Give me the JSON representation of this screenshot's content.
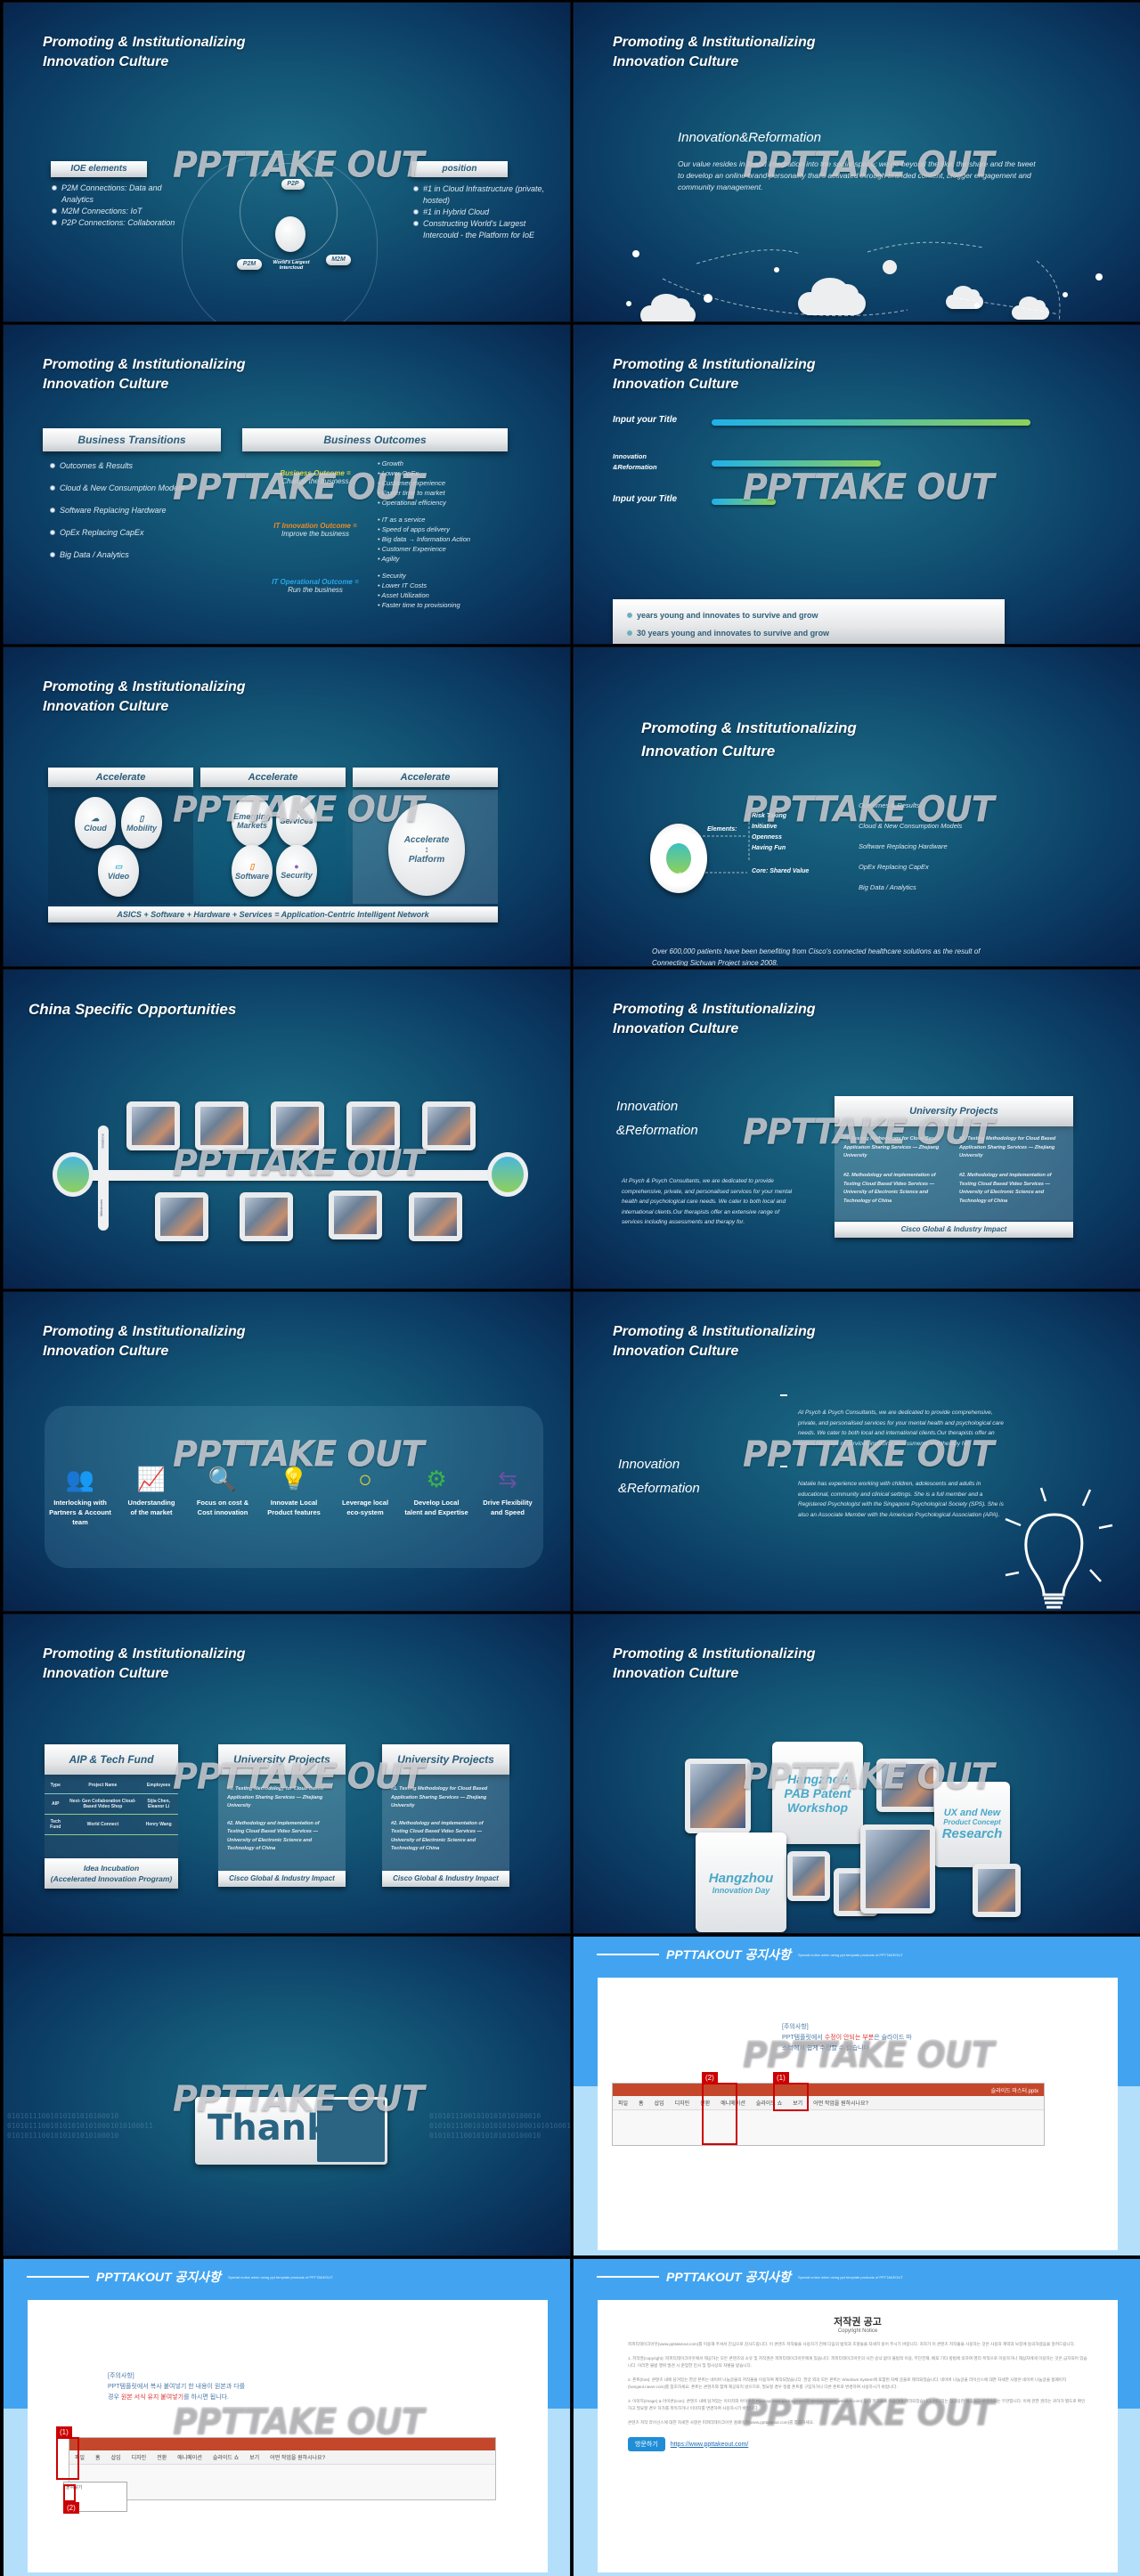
{
  "watermark": "PPTTAKE OUT",
  "common_title": "Promoting & Institutionalizing\nInnovation Culture",
  "footer_quote": "Over 600,000 patients have been benefiting from Cisco's connected healthcare solutions as the result of Connecting Sichuan Project since 2008.",
  "slides": {
    "s1": {
      "left_header": "IOE elements",
      "left_items": [
        "P2M Connections: Data and Analytics",
        "M2M Connections:  IoT",
        "P2P Connections: Collaboration"
      ],
      "center_labels": {
        "p2p": "P2P",
        "p2m": "P2M",
        "m2m": "M2M",
        "core": "World's Largest Intercloud"
      },
      "right_header": "position",
      "right_items": [
        "#1 in Cloud Infrastructure (private, hosted)",
        "#1 in Hybrid Cloud",
        "Constructing World's Largest Intercould - the Platform for IoE"
      ]
    },
    "s2": {
      "heading": "Innovation&Reformation",
      "body": "Our value resides in brand integration into the social space; we go beyond the like, the share and the tweet to develop an online brand personality that's activated through branded content, blogger engagement and community management."
    },
    "s3": {
      "left_header": "Business Transitions",
      "left_items": [
        "Outcomes & Results",
        "Cloud & New Consumption Models",
        "Software Replacing Hardware",
        "OpEx Replacing CapEx",
        "Big Data / Analytics"
      ],
      "right_header": "Business Outcomes",
      "outcomes": [
        {
          "label": "Business Outcome",
          "eq": "=",
          "sub": "Change the business",
          "color": "#e8d43a",
          "items": [
            "Growth",
            "Lower OpEx",
            "Customer experience",
            "Faster time to market",
            "Operational efficiency"
          ]
        },
        {
          "label": "IT Innovation Outcome",
          "eq": "=",
          "sub": "Improve the business",
          "color": "#f08a24",
          "items": [
            "IT as a service",
            "Speed of apps delivery",
            "Big data → Information Action",
            "Customer Experience",
            "Agility"
          ]
        },
        {
          "label": "IT Operational Outcome",
          "eq": "=",
          "sub": "Run the business",
          "color": "#2aa8e8",
          "items": [
            "Security",
            "Lower IT Costs",
            "Asset Utilization",
            "Faster time to provisioning"
          ]
        }
      ]
    },
    "s4": {
      "bars": [
        {
          "label": "Input your Title",
          "fraction": 1.0
        },
        {
          "label": "Innovation\n&Reformation",
          "fraction": 0.53
        },
        {
          "label": "Input your Title",
          "fraction": 0.2
        }
      ],
      "box_items": [
        "years young and innovates to survive and grow",
        "30 years young and innovates to survive and grow"
      ]
    },
    "s5": {
      "headers": [
        "Accelerate",
        "Accelerate",
        "Accelerate"
      ],
      "group1": [
        "Cloud",
        "Mobility",
        "Video"
      ],
      "group2": [
        "Emerging Markets",
        "Services",
        "Software",
        "Security"
      ],
      "group3": {
        "top": "Accelerate",
        "bottom": "Platform"
      },
      "footer": "ASICS + Software + Hardware + Services = Application-Centric Intelligent Network"
    },
    "s6": {
      "elements_label": "Elements:",
      "elements": [
        "Risk Taking",
        "Initiative",
        "Openness",
        "Having Fun"
      ],
      "core_label": "Core:  Shared Value",
      "right_items": [
        "Outcomes & Results",
        "Cloud & New Consumption Models",
        "Software Replacing Hardware",
        "OpEx Replacing CapEx",
        "Big Data / Analytics"
      ]
    },
    "s7": {
      "title": "China Specific Opportunities",
      "axis_top": "Solutions",
      "axis_bottom": "Milestones"
    },
    "s8": {
      "heading": "Innovation\n&Reformation",
      "body": "At Psych & Psych Consultants, we are dedicated to provide comprehensive, private, and personalised services for your mental health and psychological care needs. We cater to both local and international clients.Our therapists offer an extensive range of services including assessments and therapy for.",
      "card_header": "University  Projects",
      "card_items": [
        "#1. Testing Methodology for Cloud Based Application Sharing Services — Zhejiang University",
        "#1. Testing Methodology for Cloud Based Application Sharing Services — Zhejiang University",
        "#2. Methodology and implementation of Testing Cloud Based Video Services — University of Electronic Science and Technology of China",
        "#2. Methodology and implementation of Testing Cloud Based Video Services — University of Electronic Science and Technology of China"
      ],
      "card_footer": "Cisco Global & Industry Impact"
    },
    "s9": {
      "items": [
        {
          "label": "Interlocking with\nPartners & Account team",
          "icon": "people-icon",
          "color": "#2aa8e0"
        },
        {
          "label": "Understanding\nof the market",
          "icon": "chart-icon",
          "color": "#8cc63f"
        },
        {
          "label": "Focus on cost &\nCost innovation",
          "icon": "magnifier-icon",
          "color": "#4aa3df"
        },
        {
          "label": "Innovate Local\nProduct features",
          "icon": "lightbulb-icon",
          "color": "#f7941d"
        },
        {
          "label": "Leverage local\neco-system",
          "icon": "rings-icon",
          "color": "#e5d23a"
        },
        {
          "label": "Develop Local\ntalent and Expertise",
          "icon": "gears-icon",
          "color": "#39b54a"
        },
        {
          "label": "Drive Flexibility\nand Speed",
          "icon": "arrows-icon",
          "color": "#6b4fa0"
        }
      ]
    },
    "s10": {
      "heading": "Innovation\n&Reformation",
      "para1": "At Psych & Psych Consultants, we are dedicated to provide comprehensive, private, and personalised services for your mental health and psychological care needs. We cater to both local and international clients.Our therapists offer an extensive range of services including assessments and therapy for.",
      "para2": "Natalie has experience working with children, adolescents and adults in educational, community and clinical settings. She is a full member and a Registered Psychologist with the Singapore Psychological Society (SPS). She is also an Associate Member with the American Psychological Association (APA)."
    },
    "s11": {
      "card1": {
        "header": "AIP & Tech Fund",
        "columns": [
          "Type",
          "Project Name",
          "Employees"
        ],
        "rows": [
          [
            "AIP",
            "Next- Gen Collaboration Cloud- Based Video Shop",
            "Sijia Chen, Eleanor Li"
          ],
          [
            "Tech Fund",
            "World Connect",
            "Henry Wang"
          ]
        ],
        "footer": "Idea Incubation\n(Accelerated Innovation Program)"
      },
      "card2": {
        "header": "University  Projects",
        "items": [
          "#1. Testing Methodology for Cloud Based Application Sharing Services — Zhejiang University",
          "#2. Methodology and implementation of Testing Cloud Based Video Services — University of Electronic Science and Technology of China"
        ],
        "footer": "Cisco Global & Industry Impact"
      },
      "card3": {
        "header": "University  Projects",
        "items": [
          "#1. Testing Methodology for Cloud Based Application Sharing Services — Zhejiang University",
          "#2. Methodology and implementation of Testing Cloud Based Video Services — University of Electronic Science and Technology of China"
        ],
        "footer": "Cisco Global & Industry Impact"
      }
    },
    "s12": {
      "tiles": [
        {
          "line1": "Hangzhou",
          "line2": "PAB Patent",
          "line3": "Workshop"
        },
        {
          "line1": "Hangzhou",
          "line2": "Innovation Day"
        },
        {
          "line1": "UX and New",
          "line2": "Product Concept",
          "line3": "Research"
        }
      ]
    },
    "s13": {
      "label": "Thanks",
      "binary": [
        "01010111001010101010100010",
        "0101011100101010101010001010100011",
        "01010111001010101010100010"
      ]
    },
    "notice1": {
      "title": "PPTTAKOUT 공지사항",
      "subtitle": "Special notice when using ppt template products of PPTTAKEOUT",
      "heading": "[주의사항]",
      "line1a": "PPT템플릿에서 ",
      "line1red": "수정이 안되는 부분",
      "line1b": "은 슬라이드 마",
      "line2": "스터에서 쉽게 수정할 수 있습니다.",
      "tag1": "(1)",
      "tag2": "(2)",
      "ribbon_file": "슬라이드 마스터.pptx",
      "ribbon_tabs": [
        "파일",
        "홈",
        "삽입",
        "디자인",
        "전환",
        "애니메이션",
        "슬라이드 쇼",
        "보기",
        "어떤 작업을 원하시나요?"
      ]
    },
    "notice2": {
      "title": "PPTTAKOUT 공지사항",
      "subtitle": "Special notice when using ppt template products of PPTTAKEOUT",
      "heading": "[주의사항]",
      "line1": "PPT템플릿에서 복사 붙여넣기 한 내용이 원본과 다를",
      "line2a": "경우 ",
      "line2red": "원본 서식 유지 붙여넣기",
      "line2b": "를 하시면 됩니다.",
      "tag1": "(1)",
      "tag2": "(2)",
      "ribbon_tabs": [
        "파일",
        "홈",
        "삽입",
        "디자인",
        "전환",
        "애니메이션",
        "슬라이드 쇼",
        "보기",
        "어떤 작업을 원하시나요?"
      ],
      "paste_label": "붙여넣기"
    },
    "notice3": {
      "title": "PPTTAKOUT 공지사항",
      "subtitle": "Special notice when using ppt template products of PPTTAKEOUT",
      "heading": "저작권 공고",
      "subheading": "Copyright Notice",
      "paras": [
        "피피티테이크아웃(www.ppttakeout.com)를 이용해 주셔서 진심으로 감사드립니다. 이 콘텐츠 저작물을 사용하기 전에 다음의 법적과 조항들을 자세히 읽어 주시기 바랍니다. 귀하가 이 콘텐츠 저작물을 사용하는 것은 사용자 계약과 보증에 동의하셨음을 알려드립니다.",
        "1. 저작권(copyright): 피피티테이크아웃에서 제공하는 모든 콘텐츠의 소유 및 저작권은 피피티테이크아웃에게 있습니다. 피피티테이크아웃의 사전 승낙 없이 불법적 이용, 무단전재, 배포 기타 방법에 의하여 영리 목적으로 이용하거나 제삼자에게 이용하는 것은 금지되어 있습니다. 이러한 불법 행위 발견 시 준엄한 민사 및 형사상의 처벌을 받습니다.",
        "2. 폰트(font): 콘텐츠 내에 담겨있는 한글 폰트는 네이버 나눔글꼴의 저작물을 이용하여 제작되었습니다. 한글 외의 모든 폰트는 Windows System에 포함된 자체 글꼴로 제작되었습니다. 네이버 나눔글꼴 라이선스에 대한 자세한 사항은 네이버 나눔글꼴 홈페이지(hangeul.naver.com)를 참조하세요. 폰트는 콘텐츠와 함께 제공되지 않으므로, 필요할 경우 정품 폰트를 구입하거나 다른 폰트로 변경하여 사용하시기 바랍니다.",
        "3. 이미지(image) & 아이콘(icon): 콘텐츠 내에 담겨있는 이미지와 아이콘은 Pixabay(www.pixabay.com)와 Webalys(www.webalys.com) 등의 저작물을 이용하여 제작되었습니다. 이미지는 참고용만 제공되고 콘텐츠와는 무관합니다. 이에 관한 권리는 귀하가 별도로 확인하고 필요할 경우 허가를 취득하거나 이미지를 변경하여 사용하시기 바랍니다.",
        "콘텐츠 저작 라이선스에 대한 자세한 사항은 피피티테이크아웃 홈페이지(www.ppttakeout.com)를 참조하세요."
      ],
      "visit_button": "방문하기",
      "link": "https://www.ppttakeout.com/"
    }
  }
}
